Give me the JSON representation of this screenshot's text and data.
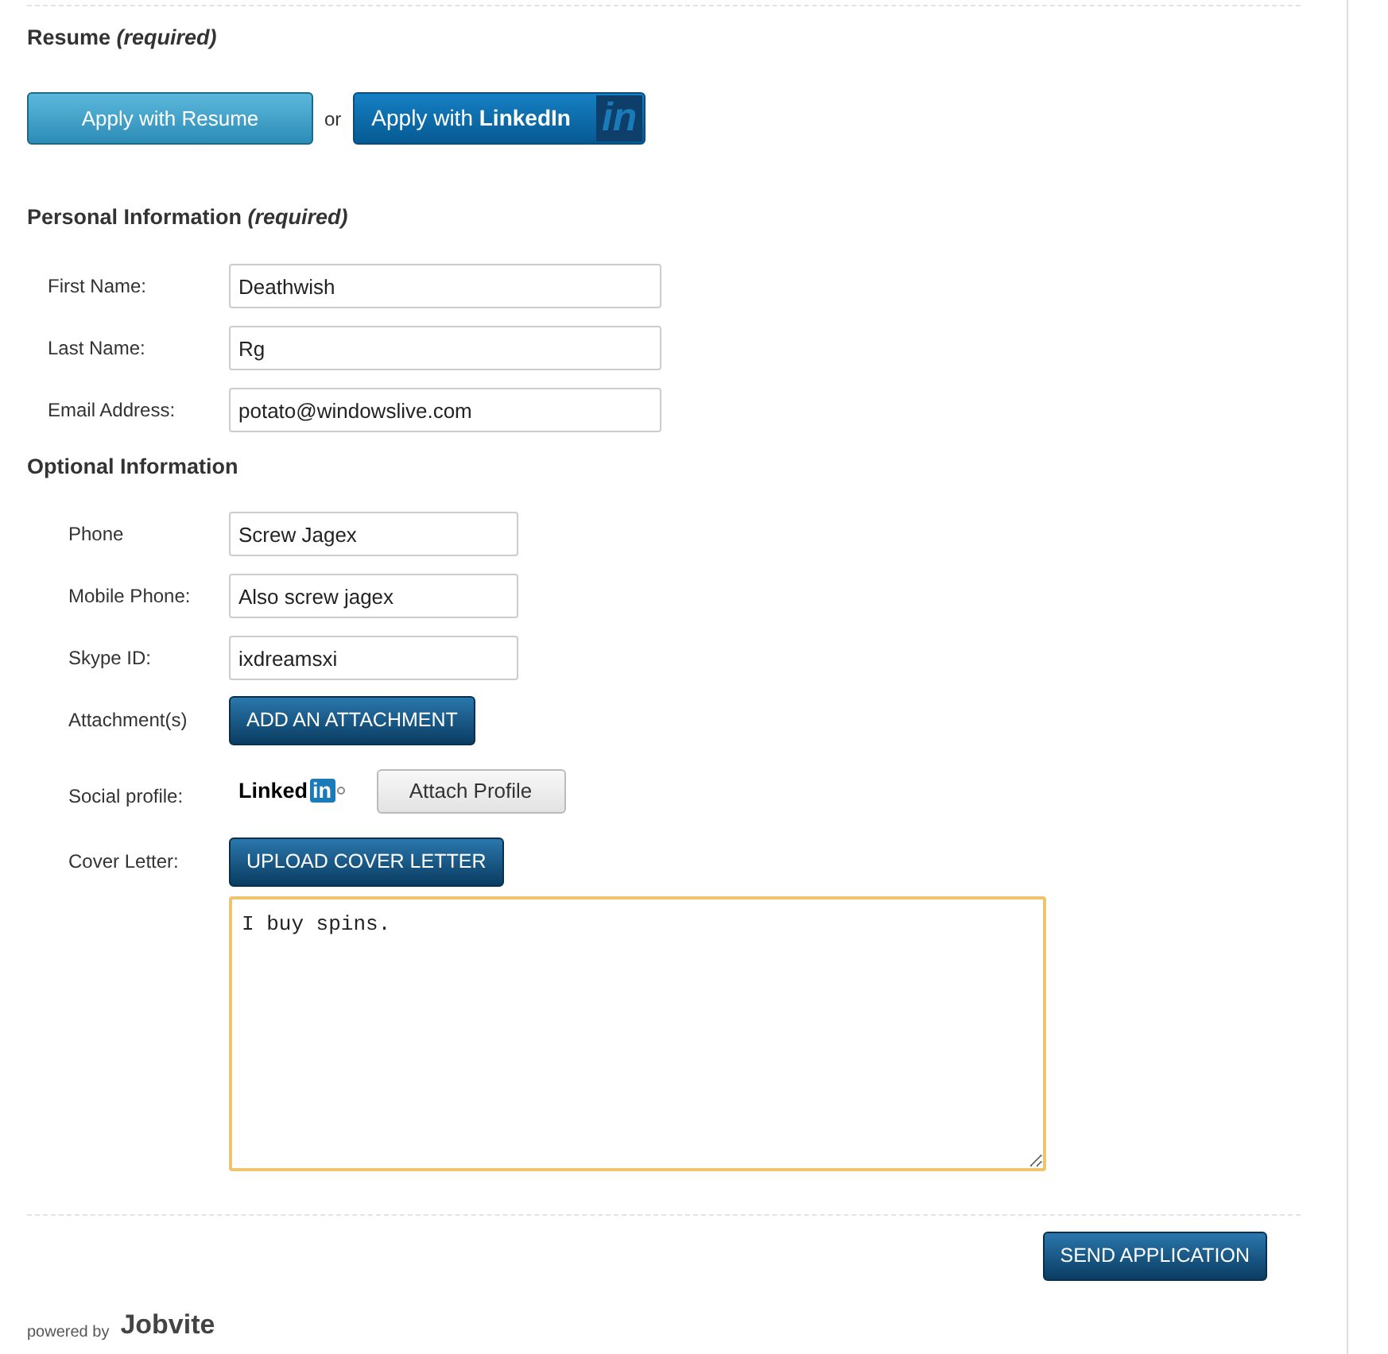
{
  "resume": {
    "heading": "Resume",
    "qualifier": "(required)",
    "resume_button": "Apply with Resume",
    "or": "or",
    "linkedin_button": {
      "prefix": "Apply with",
      "brand": "LinkedIn",
      "badge": "in"
    }
  },
  "personal": {
    "heading": "Personal Information",
    "qualifier": "(required)",
    "fields": [
      {
        "label": "First Name:",
        "value": "Deathwish"
      },
      {
        "label": "Last Name:",
        "value": "Rg"
      },
      {
        "label": "Email Address:",
        "value": "potato@windowslive.com"
      }
    ]
  },
  "optional": {
    "heading": "Optional Information",
    "rows": [
      {
        "kind": "input",
        "label": "Phone",
        "value": "Screw Jagex"
      },
      {
        "kind": "input",
        "label": "Mobile Phone:",
        "value": "Also screw jagex"
      },
      {
        "kind": "input",
        "label": "Skype ID:",
        "value": "ixdreamsxi"
      },
      {
        "kind": "button",
        "label": "Attachment(s)",
        "button": "ADD AN ATTACHMENT"
      },
      {
        "kind": "social",
        "label": "Social profile:",
        "logo_word": "Linked",
        "logo_badge": "in",
        "button": "Attach Profile"
      },
      {
        "kind": "button",
        "label": "Cover Letter:",
        "button": "UPLOAD COVER LETTER"
      }
    ],
    "cover_letter": "I buy spins."
  },
  "send_button": "SEND APPLICATION",
  "footer": {
    "powered_by": "powered by",
    "brand": "Jobvite"
  }
}
